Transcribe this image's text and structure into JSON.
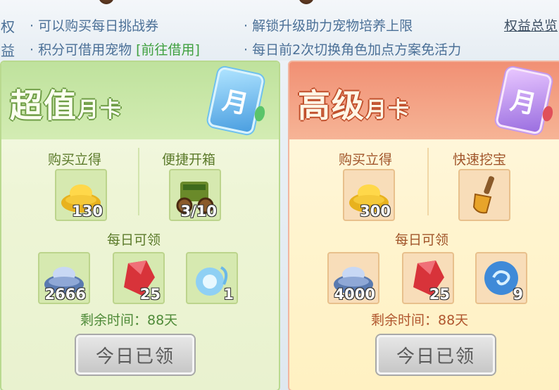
{
  "topbar": {
    "side_labels": [
      "权",
      "益"
    ],
    "line1_left": "· 可以购买每日挑战券",
    "line1_right": "· 解锁升级助力宠物培养上限",
    "line2_left": "· 积分可借用宠物",
    "line2_left_link": "[前往借用]",
    "line2_right": "· 每日前2次切换角色加点方案免活力",
    "rights_link": "权益总览"
  },
  "cards": [
    {
      "title_big": "超值",
      "title_small": "月卡",
      "badge": "月",
      "buy_label": "购买立得",
      "bonus_label": "便捷开箱",
      "buy_item": {
        "icon": "gold-ingot-icon",
        "count": "130"
      },
      "bonus_item": {
        "icon": "chest-cart-icon",
        "count": "3/10"
      },
      "daily_label": "每日可领",
      "daily_items": [
        {
          "icon": "silver-ingot-icon",
          "count": "2666"
        },
        {
          "icon": "red-crystal-icon",
          "count": "25"
        },
        {
          "icon": "spirit-orb-icon",
          "count": "1"
        }
      ],
      "remain": "剩余时间：88天",
      "button": "今日已领"
    },
    {
      "title_big": "高级",
      "title_small": "月卡",
      "badge": "月",
      "buy_label": "购买立得",
      "bonus_label": "快速挖宝",
      "buy_item": {
        "icon": "gold-ingot-icon",
        "count": "300"
      },
      "bonus_item": {
        "icon": "shovel-icon",
        "count": ""
      },
      "daily_label": "每日可领",
      "daily_items": [
        {
          "icon": "silver-ingot-icon",
          "count": "4000"
        },
        {
          "icon": "red-crystal-icon",
          "count": "25"
        },
        {
          "icon": "swirl-orb-icon",
          "count": "9"
        }
      ],
      "remain": "剩余时间：88天",
      "button": "今日已领"
    }
  ]
}
